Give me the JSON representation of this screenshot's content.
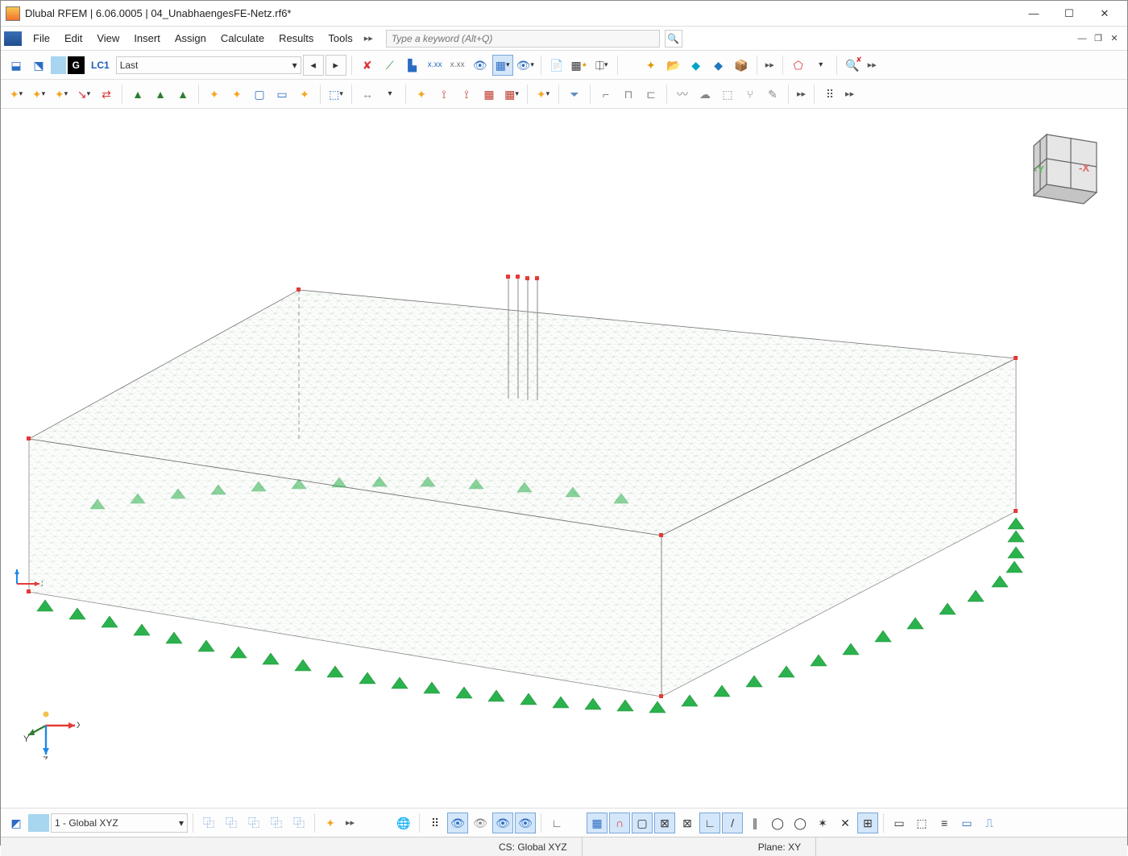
{
  "title": "Dlubal RFEM | 6.06.0005 | 04_UnabhaengesFE-Netz.rf6*",
  "menu": {
    "items": [
      "File",
      "Edit",
      "View",
      "Insert",
      "Assign",
      "Calculate",
      "Results",
      "Tools"
    ]
  },
  "search": {
    "placeholder": "Type a keyword (Alt+Q)"
  },
  "loadcase": {
    "g_label": "G",
    "code": "LC1",
    "name": "Last"
  },
  "navcube": {
    "x": "-X",
    "y": "-Y"
  },
  "axis": {
    "x": "X",
    "y": "Y",
    "z": "Z"
  },
  "view_select": {
    "value": "1 - Global XYZ"
  },
  "status": {
    "cs": "CS: Global XYZ",
    "plane": "Plane: XY"
  },
  "tb1_icons": [
    "new-model",
    "open-model",
    "sep",
    "arrow-left",
    "arrow-right",
    "sep",
    "redX",
    "member",
    "support",
    "results-xx",
    "results-xxx",
    "eye-x",
    "grid-arrow",
    "eye-arrow",
    "sep",
    "page-next",
    "grid-settings",
    "sep",
    "star-new",
    "folder-open",
    "cloud-d",
    "cloud-b",
    "package",
    "sep",
    "overflow",
    "sep",
    "select-poly",
    "dropdown",
    "sep",
    "find-x",
    "overflow"
  ],
  "tb2_icons": [
    "star1",
    "star2",
    "star3",
    "star-line",
    "line-star",
    "sep",
    "support-g1",
    "support-g2",
    "support-g3",
    "sep",
    "star-sq1",
    "star-sq2",
    "box-star",
    "box-line",
    "star-box",
    "sep",
    "box3d",
    "sep",
    "arrows-x",
    "dropdown",
    "sep",
    "star-in",
    "bracket-s",
    "bracket-m",
    "bracket-b",
    "bracket-c",
    "sep",
    "star-drop",
    "sep",
    "funnel",
    "sep",
    "bracket-l",
    "bracket-r",
    "bracket-side",
    "sep",
    "wave",
    "cloud",
    "dice",
    "branch",
    "pencil",
    "sep",
    "overflow",
    "sep",
    "grid-dots",
    "overflow"
  ],
  "bb_icons_left": [
    "work-plane",
    "sep",
    "copy1",
    "copy2",
    "copy3",
    "copy4",
    "copy5",
    "sep",
    "star-settings",
    "overflow"
  ],
  "bb_icons_mid": [
    "globe",
    "sep",
    "grid-small",
    "eye-node",
    "eye-line",
    "eye-surf",
    "eye-solid",
    "sep",
    "angle"
  ],
  "bb_icons_right": [
    "snap-grid",
    "magnet",
    "rect",
    "rect-x",
    "hatch",
    "sep",
    "corner",
    "sep",
    "slash",
    "dslash",
    "circle",
    "ellipse",
    "star6",
    "cross",
    "sep",
    "grid9",
    "sep",
    "box-thin",
    "box-dash",
    "layers",
    "rail",
    "pin"
  ]
}
